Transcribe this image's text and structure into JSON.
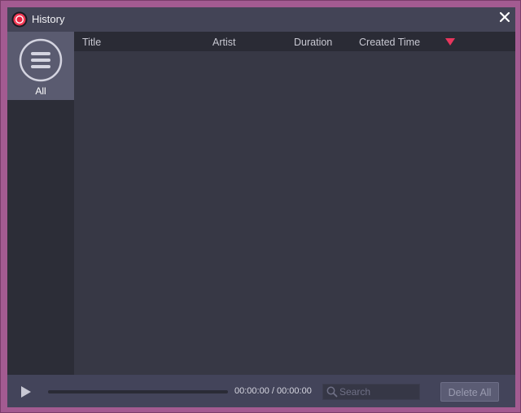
{
  "window": {
    "title": "History",
    "icon": "record-icon",
    "close_icon": "close-icon"
  },
  "sidebar": {
    "items": [
      {
        "label": "All",
        "icon": "menu-list-icon",
        "selected": true
      }
    ]
  },
  "table": {
    "columns": [
      "Title",
      "Artist",
      "Duration",
      "Created Time"
    ],
    "sort_icon": "sort-desc-icon",
    "sort_color": "#e8365d",
    "rows": []
  },
  "player": {
    "play_icon": "play-icon",
    "progress": 0,
    "time": "00:00:00 / 00:00:00"
  },
  "search": {
    "placeholder": "Search",
    "value": "",
    "icon": "search-icon"
  },
  "actions": {
    "delete_all_label": "Delete All",
    "delete_all_enabled": false
  },
  "colors": {
    "accent": "#e8365d",
    "frame": "#a35b91",
    "window_bg": "#363743",
    "titlebar_bg": "#434456",
    "sidebar_bg": "#2c2d37",
    "sidebar_selected": "#5a5b70"
  }
}
